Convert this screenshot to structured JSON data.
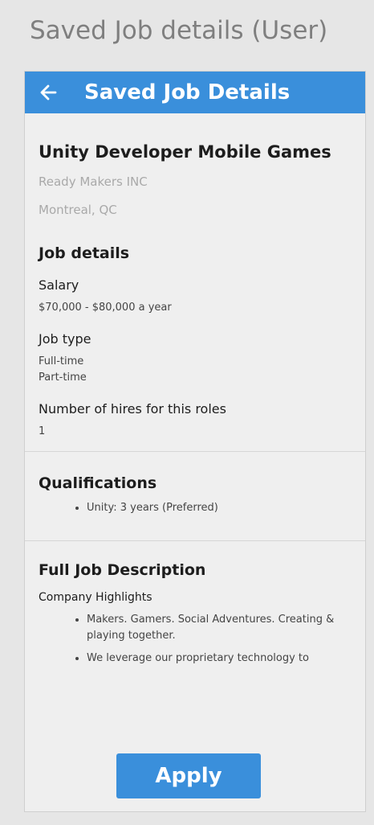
{
  "page": {
    "title": "Saved Job details (User)"
  },
  "app_bar": {
    "back_icon": "arrow-left-icon",
    "title": "Saved Job Details",
    "color": "#3a8fdb"
  },
  "job": {
    "title": "Unity Developer Mobile Games",
    "company": "Ready Makers INC",
    "location": "Montreal, QC"
  },
  "job_details": {
    "heading": "Job details",
    "salary_label": "Salary",
    "salary_value": "$70,000 - $80,000 a year",
    "job_type_label": "Job type",
    "job_types": [
      "Full-time",
      "Part-time"
    ],
    "hires_label": "Number of hires for this roles",
    "hires_value": "1"
  },
  "qualifications": {
    "heading": "Qualifications",
    "items": [
      "Unity: 3 years (Preferred)"
    ]
  },
  "description": {
    "heading": "Full Job Description",
    "subheading": "Company Highlights",
    "items": [
      "Makers. Gamers. Social Adventures. Creating & playing together.",
      "We leverage our proprietary technology to"
    ]
  },
  "actions": {
    "apply_label": "Apply"
  }
}
